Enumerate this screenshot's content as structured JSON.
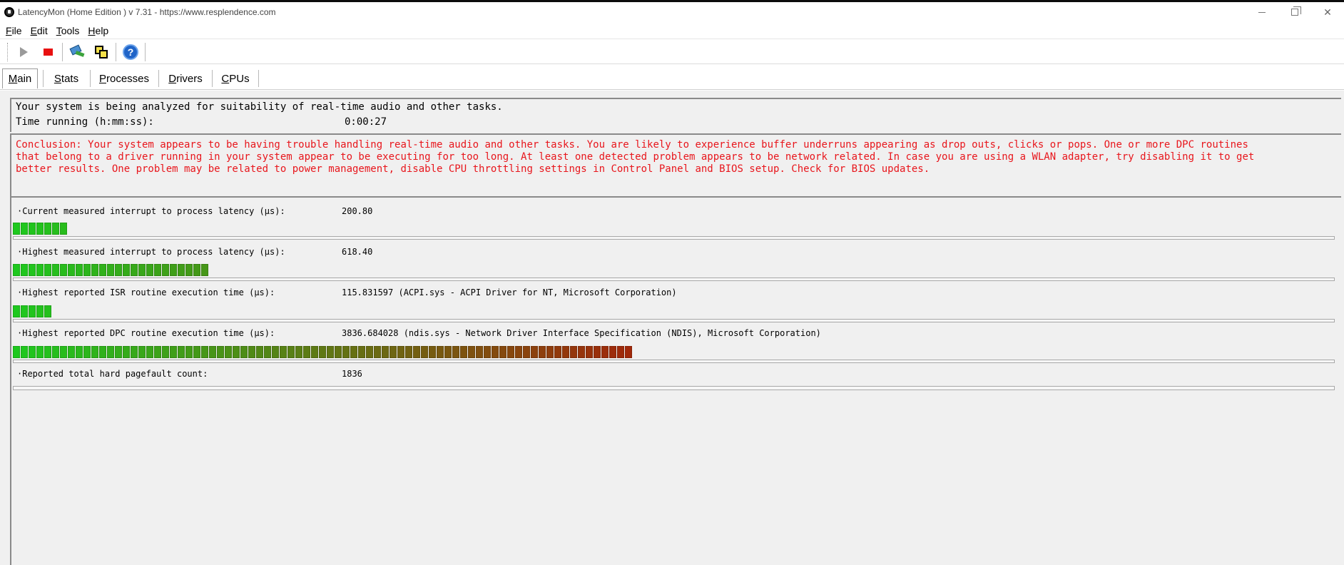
{
  "window": {
    "title": "LatencyMon  (Home Edition )  v 7.31 - https://www.resplendence.com"
  },
  "menu": {
    "items": [
      {
        "u": "F",
        "rest": "ile"
      },
      {
        "u": "E",
        "rest": "dit"
      },
      {
        "u": "T",
        "rest": "ools"
      },
      {
        "u": "H",
        "rest": "elp"
      }
    ]
  },
  "toolbar": {
    "buttons": [
      "play-icon",
      "stop-icon",
      "drivers-icon",
      "cpu-icon",
      "help-icon"
    ]
  },
  "tabs": [
    {
      "u": "M",
      "rest": "ain",
      "active": true
    },
    {
      "u": "S",
      "rest": "tats",
      "active": false
    },
    {
      "u": "P",
      "rest": "rocesses",
      "active": false
    },
    {
      "u": "D",
      "rest": "rivers",
      "active": false
    },
    {
      "u": "C",
      "rest": "PUs",
      "active": false
    }
  ],
  "status": {
    "analyzing": "Your system is being analyzed for suitability of real-time audio and other tasks.",
    "time_label": "Time running (h:mm:ss):",
    "time_value": "0:00:27"
  },
  "conclusion": "Conclusion: Your system appears to be having trouble handling real-time audio and other tasks. You are likely to experience buffer underruns appearing as drop outs, clicks or pops. One or more DPC routines\nthat belong to a driver running in your system appear to be executing for too long. At least one detected problem appears to be network related. In case you are using a WLAN adapter, try disabling it to get\nbetter results. One problem may be related to power management, disable CPU throttling settings in Control Panel and BIOS setup. Check for BIOS updates.",
  "metrics": [
    {
      "label": "·Current measured interrupt to process latency (µs):",
      "value": "200.80",
      "fill_segments": 7
    },
    {
      "label": "·Highest measured interrupt to process latency (µs):",
      "value": "618.40",
      "fill_segments": 25
    },
    {
      "label": "·Highest reported ISR routine execution time (µs):",
      "value": "115.831597  (ACPI.sys - ACPI Driver for NT, Microsoft Corporation)",
      "fill_segments": 5
    },
    {
      "label": "·Highest reported DPC routine execution time (µs):",
      "value": "3836.684028  (ndis.sys - Network Driver Interface Specification (NDIS), Microsoft Corporation)",
      "fill_segments": 79
    },
    {
      "label": "·Reported total hard pagefault count:",
      "value": "1836",
      "fill_segments": 0
    }
  ],
  "colors": {
    "warning_text": "#e8161c",
    "bar_green": "#1ec81e",
    "bar_red": "#a0280a"
  }
}
